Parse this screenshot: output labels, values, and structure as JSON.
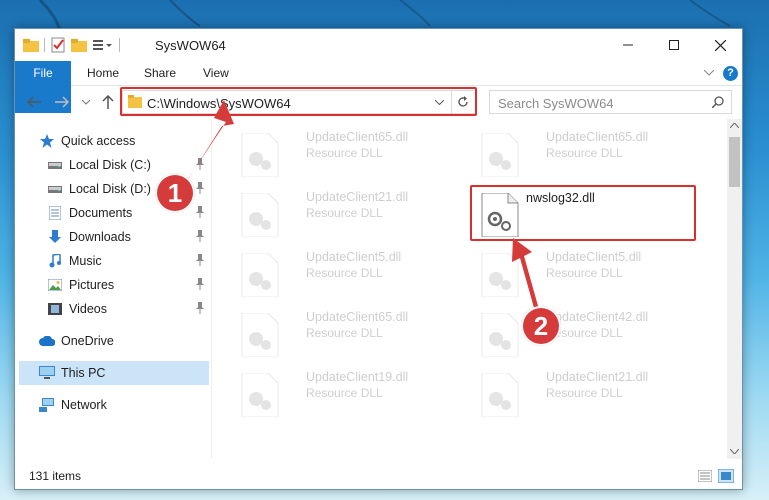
{
  "window": {
    "title": "SysWOW64"
  },
  "ribbon": {
    "tabs": [
      "File",
      "Home",
      "Share",
      "View"
    ]
  },
  "address": {
    "path": "C:\\Windows\\SysWOW64"
  },
  "search": {
    "placeholder": "Search SysWOW64"
  },
  "sidebar": {
    "items": [
      {
        "label": "Quick access",
        "icon": "star-icon"
      },
      {
        "label": "Local Disk (C:)",
        "icon": "drive-icon",
        "pinned": true
      },
      {
        "label": "Local Disk (D:)",
        "icon": "drive-icon",
        "pinned": true
      },
      {
        "label": "Documents",
        "icon": "documents-icon",
        "pinned": true
      },
      {
        "label": "Downloads",
        "icon": "download-icon",
        "pinned": true
      },
      {
        "label": "Music",
        "icon": "music-icon",
        "pinned": true
      },
      {
        "label": "Pictures",
        "icon": "pictures-icon",
        "pinned": true
      },
      {
        "label": "Videos",
        "icon": "videos-icon",
        "pinned": true
      },
      {
        "label": "OneDrive",
        "icon": "cloud-icon"
      },
      {
        "label": "This PC",
        "icon": "computer-icon",
        "selected": true
      },
      {
        "label": "Network",
        "icon": "network-icon"
      }
    ]
  },
  "files": [
    {
      "name": "UpdateClient65.dll",
      "type": "Resource DLL",
      "faded": true
    },
    {
      "name": "UpdateClient65.dll",
      "type": "Resource DLL",
      "faded": true
    },
    {
      "name": "UpdateClient21.dll",
      "type": "Resource DLL",
      "faded": true
    },
    {
      "name": "nwslog32.dll",
      "type": "",
      "faded": false,
      "highlighted": true
    },
    {
      "name": "UpdateClient5.dll",
      "type": "Resource DLL",
      "faded": true
    },
    {
      "name": "UpdateClient5.dll",
      "type": "Resource DLL",
      "faded": true
    },
    {
      "name": "UpdateClient65.dll",
      "type": "Resource DLL",
      "faded": true
    },
    {
      "name": "UpdateClient42.dll",
      "type": "Resource DLL",
      "faded": true
    },
    {
      "name": "UpdateClient19.dll",
      "type": "Resource DLL",
      "faded": true
    },
    {
      "name": "UpdateClient21.dll",
      "type": "Resource DLL",
      "faded": true
    }
  ],
  "status": {
    "item_count": "131 items"
  },
  "annotations": {
    "step1": "1",
    "step2": "2"
  },
  "colors": {
    "accent": "#1979ca",
    "annotation_red": "#d9302f",
    "selected_bg": "#cce4f7"
  }
}
